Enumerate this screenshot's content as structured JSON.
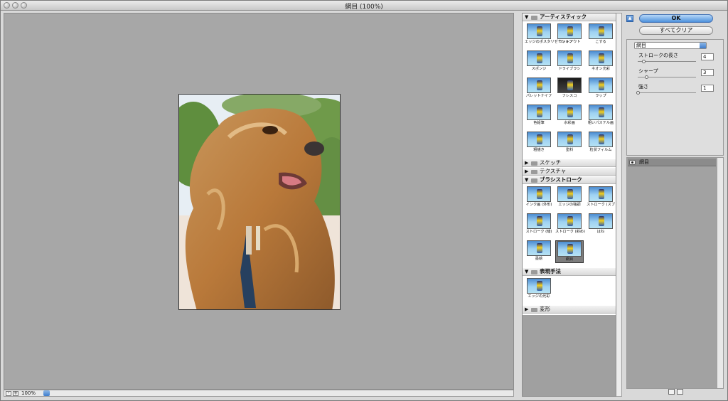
{
  "window": {
    "title": "網目 (100%)"
  },
  "preview": {
    "zoom": "100%",
    "zoom_out": "-",
    "zoom_in": "+"
  },
  "gallery": {
    "categories": [
      {
        "label": "アーティスティック",
        "expanded": true,
        "filters": [
          "エッジのポスタリゼーション",
          "カットアウト",
          "こする",
          "スポンジ",
          "ドライブラシ",
          "ネオン光彩",
          "パレットナイフ",
          "フレスコ",
          "ラップ",
          "色鉛筆",
          "水彩画",
          "粗いパステル画",
          "粗描き",
          "塗料",
          "粒状フィルム"
        ]
      },
      {
        "label": "スケッチ",
        "expanded": false,
        "filters": []
      },
      {
        "label": "テクスチャ",
        "expanded": false,
        "filters": []
      },
      {
        "label": "ブラシストローク",
        "expanded": true,
        "filters": [
          "インク画 (外形)",
          "エッジの強調",
          "ストローク (スプレー)",
          "ストローク (暗)",
          "ストローク (斜め)",
          "はね",
          "墨絵",
          "網目"
        ],
        "selected": "網目"
      },
      {
        "label": "表現手法",
        "expanded": true,
        "filters": [
          "エッジの光彩"
        ]
      },
      {
        "label": "変形",
        "expanded": false,
        "filters": []
      }
    ]
  },
  "controls": {
    "ok_label": "OK",
    "clear_label": "すべてクリア",
    "filter_select": "網目",
    "params": [
      {
        "label": "ストロークの長さ",
        "value": "4",
        "level": 0.1
      },
      {
        "label": "シャープ",
        "value": "3",
        "level": 0.15
      },
      {
        "label": "強さ",
        "value": "1",
        "level": 0.0
      }
    ]
  },
  "layers": {
    "items": [
      {
        "label": "網目"
      }
    ]
  }
}
